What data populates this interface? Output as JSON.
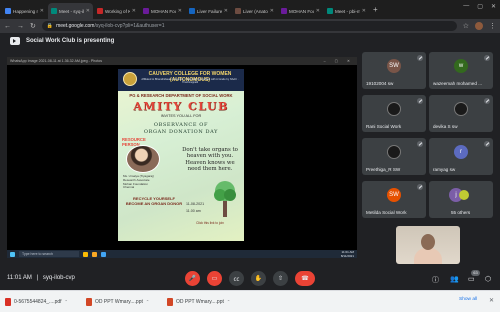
{
  "tabs": [
    {
      "title": "Happening now",
      "color": "#4285f4",
      "active": false
    },
    {
      "title": "Meet - syq-ilob",
      "color": "#00897b",
      "active": true
    },
    {
      "title": "Working of Kidney",
      "color": "#c62828",
      "active": false
    },
    {
      "title": "MOHAN Foundation",
      "color": "#6a1b9a",
      "active": false
    },
    {
      "title": "Liver Failure - Pa...",
      "color": "#1565c0",
      "active": false
    },
    {
      "title": "Liver (Anatomy): ...",
      "color": "#6d4c41",
      "active": false
    },
    {
      "title": "MOHAN Foundation",
      "color": "#6a1b9a",
      "active": false
    },
    {
      "title": "Meet - pbi-mui...",
      "color": "#00897b",
      "active": false
    }
  ],
  "address": {
    "host": "meet.google.com",
    "path": "/syq-ilob-cvp?pli=1&authuser=1"
  },
  "presenting_text": "Social Work Club is presenting",
  "viewer": {
    "title": "WhatsApp Image 2021-08-11 at 1.36.32 AM.jpeg - Photos",
    "search": "Type here to search",
    "clock_time": "11:01 AM",
    "clock_date": "8/11/2021"
  },
  "poster": {
    "college": "CAUVERY COLLEGE FOR WOMEN (AUTONOMOUS)",
    "college_sub": "Affiliated to Bharathidasan University · Nationally Accredited with A Grade by NAAC · Tiruchirappalli",
    "dept": "PG & RESEARCH DEPARTMENT OF SOCIAL WORK",
    "club": "AMITY CLUB",
    "invites": "INVITES YOU ALL FOR",
    "obs1": "OBSERVANCE OF",
    "obs2": "ORGAN DONATION DAY",
    "rp_label": "RESOURCE PERSON",
    "person1": "Ms. Umaiya (Tiyagaraj)",
    "person2": "Research Associate",
    "person3": "Mohan Foundation",
    "person4": "Chennai",
    "quote": "Don't take organs to heaven with you. Heaven knows we need them here.",
    "recycle": "RECYCLE YOURSELF BECOME AN ORGAN DONOR",
    "date": "11-08-2021",
    "time": "11.00 am",
    "click": "Click this link to join"
  },
  "participants": [
    {
      "name": "19102004 sw",
      "initials": "SW",
      "color": "#795548",
      "tile": "t1"
    },
    {
      "name": "wazeemah mohamed ...",
      "initials": "w",
      "color": "#33691e",
      "tile": "t2"
    },
    {
      "name": "Rani Social Work",
      "initials": "",
      "color": "#1a1a1a",
      "tile": "t3"
    },
    {
      "name": "devika S sw",
      "initials": "",
      "color": "#1a1a1a",
      "tile": "t4"
    },
    {
      "name": "Preethiga_R SW",
      "initials": "",
      "color": "#1a1a1a",
      "tile": "t5"
    },
    {
      "name": "ramyag sw",
      "initials": "r",
      "color": "#5c6bc0",
      "tile": "t6"
    },
    {
      "name": "Metilda Social Work",
      "initials": "SW",
      "color": "#e65100",
      "tile": "t7"
    },
    {
      "name": "55 others",
      "initials": "",
      "color": "#3c4043",
      "tile": "t8"
    }
  ],
  "callbar": {
    "time": "11:01 AM",
    "separator": "|",
    "meeting_code": "syq-ilob-cvp",
    "people_count": "63"
  },
  "downloads": [
    {
      "name": "0-5675544824_....pdf",
      "type": "pdf"
    },
    {
      "name": "OD PPT Wmary....ppt",
      "type": "ppt"
    },
    {
      "name": "OD PPT Wmary....ppt",
      "type": "ppt"
    }
  ],
  "show_all": "Show all"
}
